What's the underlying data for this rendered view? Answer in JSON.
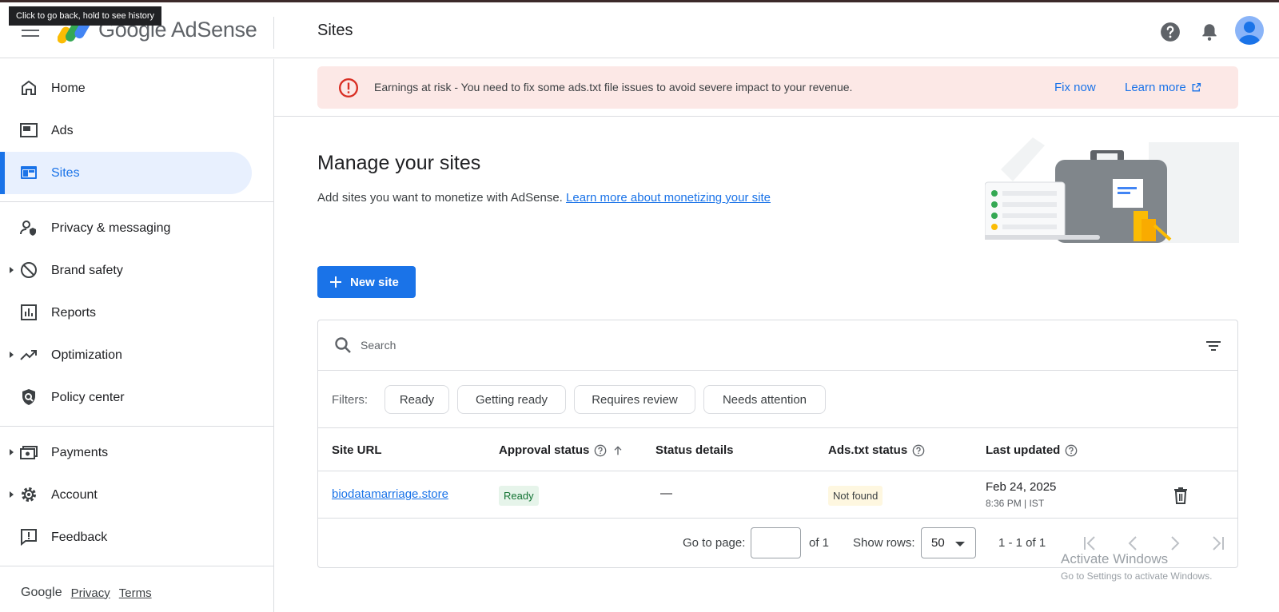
{
  "tooltip": "Click to go back, hold to see history",
  "header": {
    "logo_text": "Google AdSense",
    "page_title": "Sites"
  },
  "nav": {
    "items": [
      {
        "label": "Home"
      },
      {
        "label": "Ads"
      },
      {
        "label": "Sites"
      },
      {
        "label": "Privacy & messaging"
      },
      {
        "label": "Brand safety"
      },
      {
        "label": "Reports"
      },
      {
        "label": "Optimization"
      },
      {
        "label": "Policy center"
      },
      {
        "label": "Payments"
      },
      {
        "label": "Account"
      },
      {
        "label": "Feedback"
      }
    ],
    "active": "Sites",
    "footer": {
      "brand": "Google",
      "privacy": "Privacy",
      "terms": "Terms"
    }
  },
  "alert": {
    "message": "Earnings at risk - You need to fix some ads.txt file issues to avoid severe impact to your revenue.",
    "fix_now": "Fix now",
    "learn_more": "Learn more"
  },
  "main": {
    "heading": "Manage your sites",
    "subtitle": "Add sites you want to monetize with AdSense.",
    "subtitle_link": "Learn more about monetizing your site",
    "new_site_label": "New site"
  },
  "table": {
    "search_placeholder": "Search",
    "filters_label": "Filters:",
    "filters": [
      "Ready",
      "Getting ready",
      "Requires review",
      "Needs attention"
    ],
    "columns": [
      "Site URL",
      "Approval status",
      "Status details",
      "Ads.txt status",
      "Last updated"
    ],
    "rows": [
      {
        "site_url": "biodatamarriage.store",
        "approval_status": "Ready",
        "status_details": "—",
        "ads_txt_status": "Not found",
        "last_updated_date": "Feb 24, 2025",
        "last_updated_time": "8:36 PM | IST"
      }
    ],
    "pager": {
      "go_to_page": "Go to page:",
      "of_pages": "of 1",
      "show_rows": "Show rows:",
      "rows_value": "50",
      "range": "1 - 1 of 1"
    }
  },
  "watermark": {
    "line1": "Activate Windows",
    "line2": "Go to Settings to activate Windows."
  },
  "colors": {
    "accent": "#1a73e8",
    "alert_bg": "#fce8e6",
    "alert_icon": "#d93025",
    "ready_bg": "#e6f4ea",
    "not_found_bg": "#fef7e0"
  }
}
